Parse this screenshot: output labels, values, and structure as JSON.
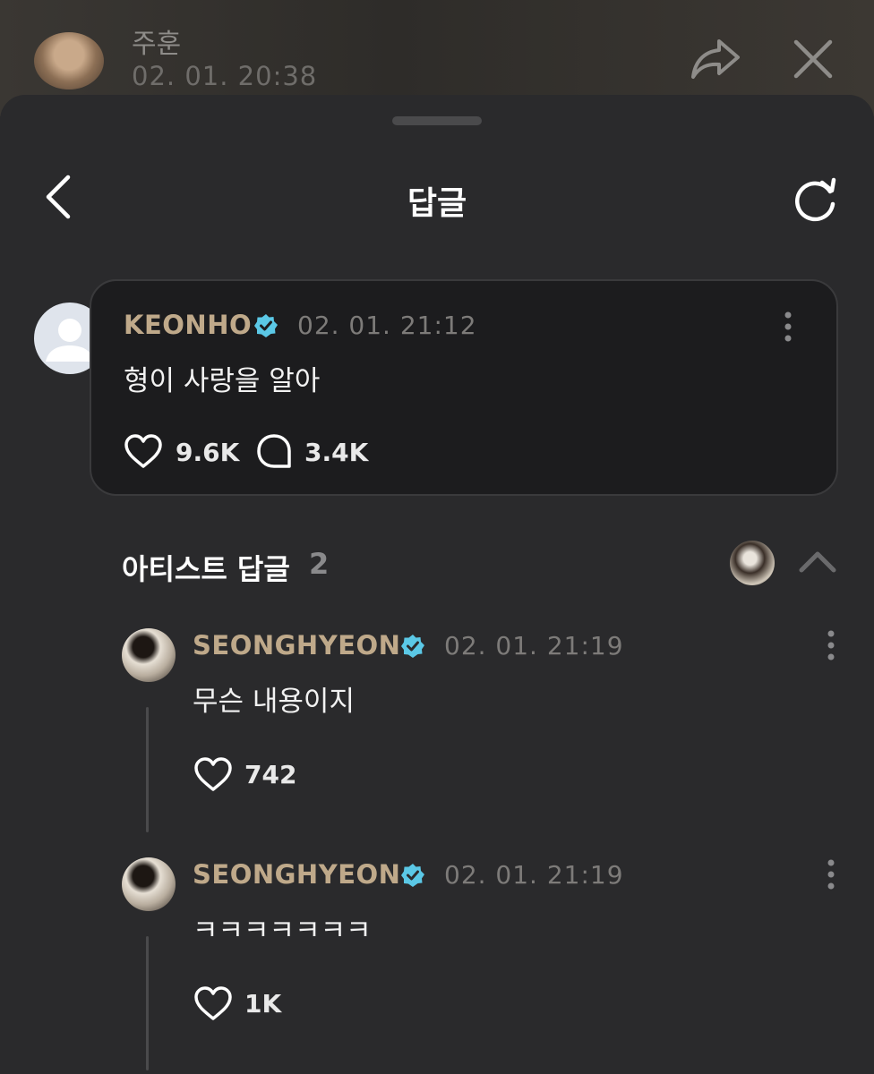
{
  "background_post": {
    "author": "주훈",
    "timestamp": "02. 01. 20:38",
    "share_icon": "share-icon",
    "close_icon": "close-icon"
  },
  "sheet": {
    "title": "답글",
    "back_icon": "chevron-left-icon",
    "refresh_icon": "refresh-icon"
  },
  "parent_comment": {
    "author": "KEONHO",
    "verified": true,
    "timestamp": "02. 01. 21:12",
    "text": "형이 사랑을 알아",
    "likes": "9.6K",
    "replies": "3.4K"
  },
  "artist_replies": {
    "title": "아티스트 답글",
    "count": "2",
    "collapse_icon": "chevron-up-icon",
    "items": [
      {
        "author": "SEONGHYEON",
        "verified": true,
        "timestamp": "02. 01. 21:19",
        "text": "무슨 내용이지",
        "likes": "742"
      },
      {
        "author": "SEONGHYEON",
        "verified": true,
        "timestamp": "02. 01. 21:19",
        "text": "ㅋㅋㅋㅋㅋㅋㅋ",
        "likes": "1K"
      }
    ]
  },
  "colors": {
    "sheet_bg": "#2a2a2c",
    "card_bg": "#1c1c1e",
    "author_gold": "#bfa98a",
    "verified_blue": "#5bc8e6",
    "muted": "#7d7b79"
  }
}
